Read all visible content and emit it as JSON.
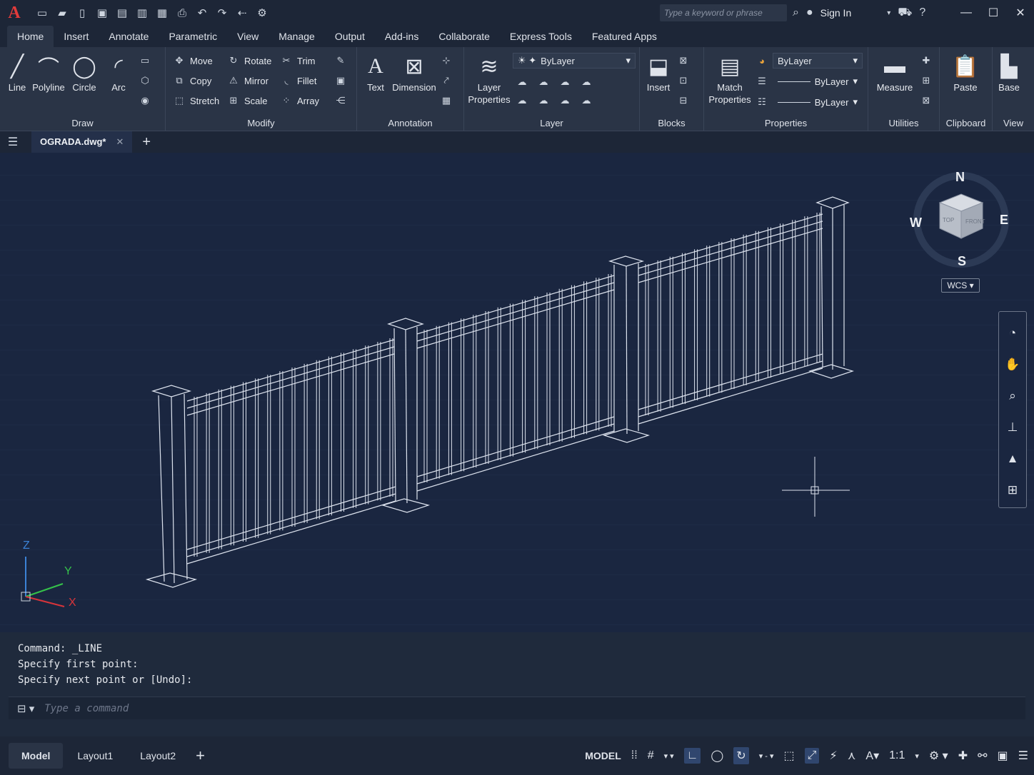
{
  "titlebar": {
    "logo": "A",
    "qat_icons": [
      "new-icon",
      "open-icon",
      "open-web-icon",
      "save-icon",
      "save-web-icon",
      "save-as-icon",
      "plot-icon",
      "print-icon",
      "undo-icon",
      "redo-icon",
      "undo-dropdown-icon",
      "workspace-icon"
    ],
    "search_placeholder": "Type a keyword or phrase",
    "sign_in": "Sign In"
  },
  "tabs": [
    "Home",
    "Insert",
    "Annotate",
    "Parametric",
    "View",
    "Manage",
    "Output",
    "Add-ins",
    "Collaborate",
    "Express Tools",
    "Featured Apps"
  ],
  "ribbon": {
    "draw": {
      "label": "Draw",
      "line": "Line",
      "polyline": "Polyline",
      "circle": "Circle",
      "arc": "Arc"
    },
    "modify": {
      "label": "Modify",
      "move": "Move",
      "rotate": "Rotate",
      "trim": "Trim",
      "copy": "Copy",
      "mirror": "Mirror",
      "fillet": "Fillet",
      "stretch": "Stretch",
      "scale": "Scale",
      "array": "Array"
    },
    "annotation": {
      "label": "Annotation",
      "text": "Text",
      "dimension": "Dimension"
    },
    "layer": {
      "label": "Layer",
      "layer_properties_1": "Layer",
      "layer_properties_2": "Properties",
      "current": "ByLayer"
    },
    "blocks": {
      "label": "Blocks",
      "insert": "Insert"
    },
    "properties": {
      "label": "Properties",
      "match_1": "Match",
      "match_2": "Properties",
      "color": "ByLayer",
      "linetype": "ByLayer",
      "lineweight": "ByLayer"
    },
    "utilities": {
      "label": "Utilities",
      "measure": "Measure"
    },
    "clipboard": {
      "label": "Clipboard",
      "paste": "Paste"
    },
    "view": {
      "label": "View",
      "base": "Base"
    }
  },
  "document_tab": "OGRADA.dwg*",
  "viewcube": {
    "n": "N",
    "s": "S",
    "e": "E",
    "w": "W",
    "top": "TOP",
    "front": "FRONT",
    "wcs": "WCS"
  },
  "ucs": {
    "x": "X",
    "y": "Y",
    "z": "Z"
  },
  "command": {
    "history": [
      "Command:  _LINE",
      "Specify first point:",
      "Specify next point or [Undo]:"
    ],
    "placeholder": "Type a command"
  },
  "layouts": [
    "Model",
    "Layout1",
    "Layout2"
  ],
  "status": {
    "model": "MODEL",
    "scale": "1:1"
  },
  "colors": {
    "canvas": "#1a2640",
    "wire": "#dde3ee",
    "accent_red": "#e23b3b"
  }
}
